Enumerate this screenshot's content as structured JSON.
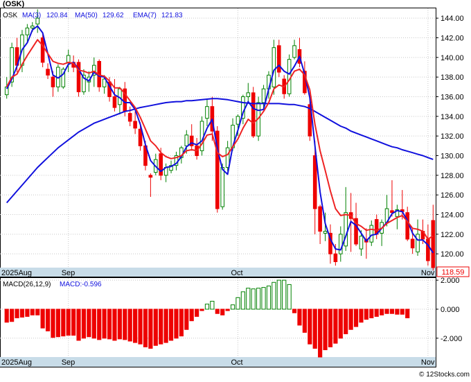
{
  "header": {
    "title": "(OSK)"
  },
  "legend": {
    "symbol": "OSK",
    "ma3": "MA(3)",
    "ma3_val": "120.84",
    "ma50": "MA(50)",
    "ma50_val": "129.62",
    "ema7": "EMA(7)",
    "ema7_val": "121.83"
  },
  "macd_legend": {
    "params": "MACD(26,12,9)",
    "value": "MACD:-0.596"
  },
  "last_price": "118.59",
  "watermark": "© 12Stocks.com",
  "colors": {
    "up": "#008000",
    "down": "#ee0000",
    "ma": "#1010dd",
    "ema": "#ee2222",
    "axisband": "#c8dce8"
  },
  "chart_data": [
    {
      "type": "candlestick",
      "symbol": "OSK",
      "y_ticks": [
        "144.00",
        "142.00",
        "140.00",
        "138.00",
        "136.00",
        "134.00",
        "132.00",
        "130.00",
        "128.00",
        "126.00",
        "124.00",
        "122.00",
        "120.00"
      ],
      "ylim": [
        118.6,
        145.0
      ],
      "x_labels": [
        {
          "text": "2025Aug",
          "idx": 0
        },
        {
          "text": "Sep",
          "idx": 12
        },
        {
          "text": "Oct",
          "idx": 45
        },
        {
          "text": "Nov",
          "idx": 82
        }
      ],
      "candles": [
        [
          136.2,
          138.0,
          135.8,
          137.0
        ],
        [
          137.5,
          141.5,
          137.0,
          141.0
        ],
        [
          141.0,
          142.0,
          138.5,
          139.2
        ],
        [
          139.2,
          142.8,
          138.5,
          142.3
        ],
        [
          142.3,
          143.4,
          141.5,
          143.0
        ],
        [
          143.0,
          143.6,
          142.6,
          143.2
        ],
        [
          143.4,
          144.9,
          142.5,
          144.0
        ],
        [
          142.0,
          142.5,
          139.0,
          139.5
        ],
        [
          138.8,
          139.4,
          137.8,
          138.2
        ],
        [
          138.0,
          138.6,
          136.0,
          137.0
        ],
        [
          137.0,
          139.3,
          136.5,
          139.0
        ],
        [
          137.0,
          139.0,
          136.8,
          138.8
        ],
        [
          139.5,
          140.8,
          138.5,
          140.2
        ],
        [
          139.5,
          140.2,
          138.5,
          139.0
        ],
        [
          139.5,
          139.8,
          136.0,
          136.5
        ],
        [
          136.5,
          138.8,
          136.2,
          138.2
        ],
        [
          137.5,
          138.6,
          136.5,
          138.0
        ],
        [
          138.2,
          140.0,
          137.0,
          139.2
        ],
        [
          139.6,
          139.8,
          136.5,
          137.0
        ],
        [
          137.0,
          138.2,
          136.3,
          137.8
        ],
        [
          137.5,
          138.0,
          135.5,
          136.0
        ],
        [
          136.0,
          137.8,
          134.5,
          134.9
        ],
        [
          135.2,
          137.0,
          134.2,
          136.8
        ],
        [
          136.8,
          137.5,
          134.0,
          134.5
        ],
        [
          134.3,
          135.0,
          133.0,
          133.5
        ],
        [
          133.5,
          134.5,
          132.2,
          132.8
        ],
        [
          132.7,
          133.4,
          130.5,
          131.0
        ],
        [
          131.0,
          131.5,
          128.5,
          129.0
        ],
        [
          128.0,
          128.2,
          125.8,
          127.8
        ],
        [
          128.3,
          130.2,
          128.0,
          129.6
        ],
        [
          130.2,
          130.8,
          127.5,
          128.0
        ],
        [
          128.0,
          129.2,
          127.3,
          128.8
        ],
        [
          128.5,
          129.5,
          128.2,
          129.0
        ],
        [
          129.0,
          130.4,
          128.5,
          130.0
        ],
        [
          129.8,
          131.0,
          129.2,
          130.8
        ],
        [
          131.0,
          132.6,
          130.2,
          132.1
        ],
        [
          132.0,
          133.2,
          130.5,
          131.0
        ],
        [
          131.0,
          131.8,
          129.6,
          130.0
        ],
        [
          130.5,
          134.0,
          130.0,
          133.5
        ],
        [
          133.8,
          135.8,
          133.0,
          135.0
        ],
        [
          135.0,
          136.0,
          131.5,
          132.5
        ],
        [
          132.5,
          133.0,
          124.2,
          124.6
        ],
        [
          124.8,
          129.2,
          124.5,
          128.8
        ],
        [
          128.8,
          131.5,
          128.4,
          130.8
        ],
        [
          130.8,
          133.8,
          130.5,
          133.1
        ],
        [
          133.2,
          134.2,
          132.0,
          134.0
        ],
        [
          133.8,
          136.2,
          133.2,
          136.0
        ],
        [
          136.0,
          137.4,
          135.5,
          136.4
        ],
        [
          136.4,
          137.0,
          131.8,
          132.0
        ],
        [
          132.0,
          136.0,
          131.5,
          135.4
        ],
        [
          135.4,
          137.2,
          134.8,
          136.8
        ],
        [
          136.8,
          138.6,
          135.8,
          138.2
        ],
        [
          137.0,
          141.8,
          136.2,
          141.0
        ],
        [
          141.2,
          141.8,
          138.0,
          138.5
        ],
        [
          137.8,
          138.2,
          135.8,
          136.3
        ],
        [
          136.3,
          140.3,
          136.0,
          139.8
        ],
        [
          140.0,
          141.8,
          139.8,
          141.2
        ],
        [
          140.8,
          142.0,
          139.0,
          139.4
        ],
        [
          138.6,
          139.6,
          136.2,
          136.4
        ],
        [
          135.2,
          136.0,
          131.5,
          132.0
        ],
        [
          130.0,
          131.5,
          122.0,
          124.6
        ],
        [
          124.8,
          125.0,
          121.0,
          122.3
        ],
        [
          122.1,
          124.2,
          121.3,
          122.3
        ],
        [
          122.1,
          123.0,
          119.0,
          120.0
        ],
        [
          120.0,
          121.0,
          118.8,
          119.2
        ],
        [
          120.0,
          122.8,
          119.2,
          122.0
        ],
        [
          120.8,
          126.8,
          120.3,
          124.2
        ],
        [
          124.2,
          126.2,
          120.2,
          123.6
        ],
        [
          123.6,
          125.2,
          120.8,
          121.0
        ],
        [
          120.5,
          122.4,
          119.8,
          121.8
        ],
        [
          121.5,
          122.6,
          119.5,
          121.2
        ],
        [
          121.2,
          123.4,
          120.8,
          122.9
        ],
        [
          123.5,
          124.0,
          121.5,
          122.0
        ],
        [
          122.1,
          123.5,
          120.8,
          123.2
        ],
        [
          123.2,
          126.0,
          122.8,
          124.6
        ],
        [
          124.4,
          127.5,
          123.8,
          124.2
        ],
        [
          123.8,
          125.0,
          122.5,
          124.5
        ],
        [
          124.5,
          126.5,
          123.5,
          124.3
        ],
        [
          124.2,
          124.8,
          121.3,
          121.5
        ],
        [
          121.5,
          122.6,
          120.0,
          120.6
        ],
        [
          120.2,
          123.5,
          119.8,
          122.0
        ],
        [
          122.3,
          123.5,
          121.0,
          121.5
        ],
        [
          121.5,
          123.0,
          118.8,
          119.3
        ],
        [
          123.4,
          125.0,
          118.3,
          118.6
        ]
      ],
      "series": [
        {
          "name": "MA(3)",
          "values": [
            136.8,
            137.8,
            139.1,
            140.8,
            141.5,
            142.8,
            143.2,
            142.5,
            140.4,
            138.2,
            137.9,
            138.3,
            139.3,
            139.5,
            138.8,
            137.9,
            137.6,
            138.5,
            138.1,
            138.0,
            137.1,
            136.2,
            135.9,
            135.4,
            135.4,
            134.7,
            133.2,
            131.1,
            129.5,
            128.9,
            128.4,
            128.8,
            128.9,
            129.2,
            129.9,
            130.9,
            131.3,
            131.1,
            131.5,
            132.8,
            133.7,
            130.7,
            128.6,
            128.1,
            130.9,
            132.6,
            134.4,
            135.5,
            134.8,
            134.6,
            134.7,
            136.8,
            138.7,
            139.2,
            138.6,
            138.3,
            139.1,
            140.1,
            138.3,
            135.9,
            131.0,
            126.3,
            123.1,
            121.5,
            120.5,
            120.4,
            121.8,
            123.3,
            122.9,
            122.1,
            121.3,
            121.9,
            122.0,
            122.6,
            123.2,
            124.1,
            124.4,
            124.3,
            123.4,
            122.1,
            121.4,
            121.4,
            120.9,
            120.1
          ]
        },
        {
          "name": "MA(50)",
          "values": [
            125.2,
            125.8,
            126.4,
            127.0,
            127.6,
            128.2,
            128.8,
            129.3,
            129.8,
            130.3,
            130.8,
            131.2,
            131.6,
            132.0,
            132.4,
            132.7,
            133.0,
            133.3,
            133.5,
            133.7,
            133.9,
            134.1,
            134.3,
            134.5,
            134.6,
            134.75,
            134.9,
            135.0,
            135.1,
            135.2,
            135.3,
            135.4,
            135.45,
            135.5,
            135.5,
            135.6,
            135.6,
            135.65,
            135.7,
            135.75,
            135.8,
            135.8,
            135.75,
            135.7,
            135.6,
            135.5,
            135.4,
            135.35,
            135.3,
            135.3,
            135.3,
            135.3,
            135.3,
            135.3,
            135.25,
            135.2,
            135.2,
            135.1,
            135.0,
            134.8,
            134.5,
            134.2,
            133.9,
            133.6,
            133.3,
            133.0,
            132.8,
            132.5,
            132.3,
            132.1,
            131.9,
            131.7,
            131.5,
            131.3,
            131.1,
            130.9,
            130.8,
            130.6,
            130.45,
            130.3,
            130.15,
            130.0,
            129.8,
            129.62
          ]
        },
        {
          "name": "EMA(7)",
          "values": [
            137.0,
            138.0,
            138.3,
            139.3,
            140.2,
            141.0,
            141.8,
            141.2,
            140.4,
            139.6,
            139.4,
            139.3,
            139.5,
            139.4,
            138.7,
            138.6,
            138.4,
            138.6,
            138.2,
            138.1,
            137.6,
            136.9,
            136.9,
            136.3,
            135.6,
            134.9,
            133.9,
            132.7,
            131.5,
            131.0,
            130.3,
            129.9,
            129.7,
            129.8,
            130.0,
            130.5,
            130.6,
            130.5,
            131.2,
            132.1,
            132.2,
            130.3,
            129.9,
            130.1,
            130.9,
            131.7,
            132.8,
            133.7,
            133.3,
            133.8,
            134.5,
            135.4,
            136.8,
            137.2,
            137.0,
            137.7,
            138.6,
            138.8,
            138.2,
            136.7,
            133.2,
            130.5,
            128.5,
            126.4,
            124.6,
            123.9,
            124.0,
            123.9,
            123.1,
            122.8,
            122.4,
            122.5,
            122.4,
            122.6,
            123.1,
            123.4,
            123.7,
            123.9,
            123.3,
            122.6,
            122.5,
            122.3,
            121.5,
            121.83
          ]
        }
      ]
    },
    {
      "type": "bar",
      "name": "MACD(26,12,9)",
      "y_ticks": [
        "2.000",
        "0.000",
        "-2.000"
      ],
      "ylim": [
        -3.3,
        2.15
      ],
      "values": [
        -0.9,
        -0.85,
        -0.6,
        -0.55,
        -0.5,
        -0.4,
        -0.4,
        -1.3,
        -1.5,
        -1.95,
        -1.9,
        -1.85,
        -1.8,
        -1.8,
        -2.15,
        -2.0,
        -1.9,
        -2.0,
        -2.1,
        -2.0,
        -2.05,
        -2.15,
        -2.05,
        -2.1,
        -2.2,
        -2.3,
        -2.4,
        -2.6,
        -2.7,
        -2.5,
        -2.4,
        -2.3,
        -2.15,
        -2.0,
        -1.85,
        -1.4,
        -0.8,
        -0.5,
        -0.1,
        0.35,
        0.55,
        -0.3,
        -0.4,
        -0.1,
        0.3,
        0.8,
        1.2,
        1.45,
        1.4,
        1.45,
        1.5,
        1.6,
        1.85,
        2.0,
        2.0,
        1.7,
        -0.25,
        -1.1,
        -1.6,
        -2.4,
        -2.7,
        -3.3,
        -2.8,
        -2.6,
        -2.35,
        -2.0,
        -1.7,
        -1.4,
        -1.2,
        -0.9,
        -0.7,
        -0.6,
        -0.5,
        -0.4,
        -0.3,
        -0.3,
        -0.35,
        -0.35,
        -0.6
      ]
    }
  ]
}
